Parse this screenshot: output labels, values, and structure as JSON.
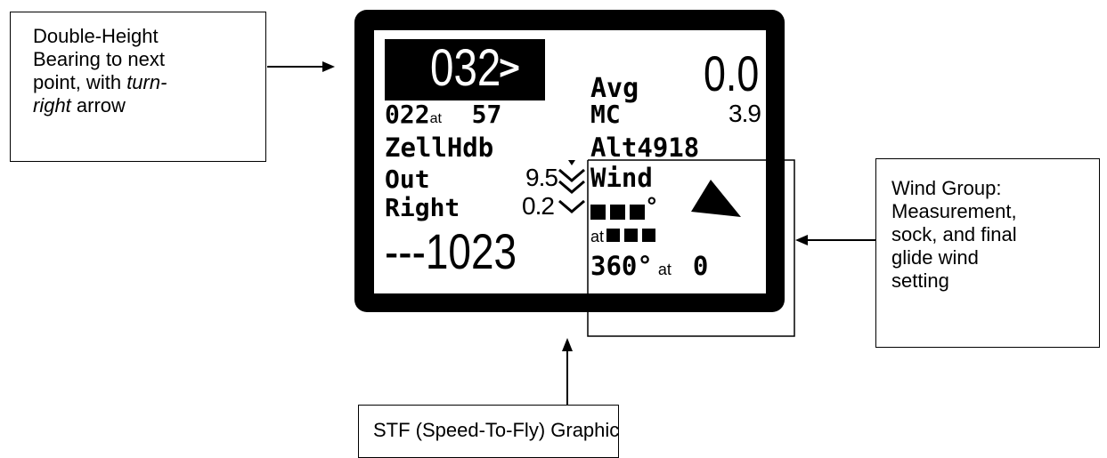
{
  "callouts": {
    "bearing": {
      "lines": [
        "Double-Height",
        "Bearing to next",
        "point, with",
        "arrow"
      ],
      "italic": "turn-",
      "italic2": "right"
    },
    "wind": {
      "lines": [
        "Wind  Group:",
        "Measurement,",
        "sock, and final",
        "glide wind",
        "setting"
      ]
    },
    "stf": {
      "text": "STF (Speed-To-Fly) Graphic"
    }
  },
  "display": {
    "bearing_value": "032",
    "bearing_arrow": ">",
    "row2_left_a": "022",
    "row2_left_b": "at",
    "row2_left_c": "57",
    "waypoint": "ZellHdb",
    "out_label": "Out",
    "out_value": "9.5",
    "right_label": "Right",
    "right_value": "0.2",
    "big_left": "---1023",
    "avg_label": "Avg",
    "avg_value": "0.0",
    "mc_label": "MC",
    "mc_value": "3.9",
    "alt_label": "Alt",
    "alt_value": "4918",
    "wind_label": "Wind",
    "wind_deg": "°",
    "wind_at": "at",
    "wind_final_dir": "360°",
    "wind_final_at": "at",
    "wind_final_speed": "0"
  }
}
